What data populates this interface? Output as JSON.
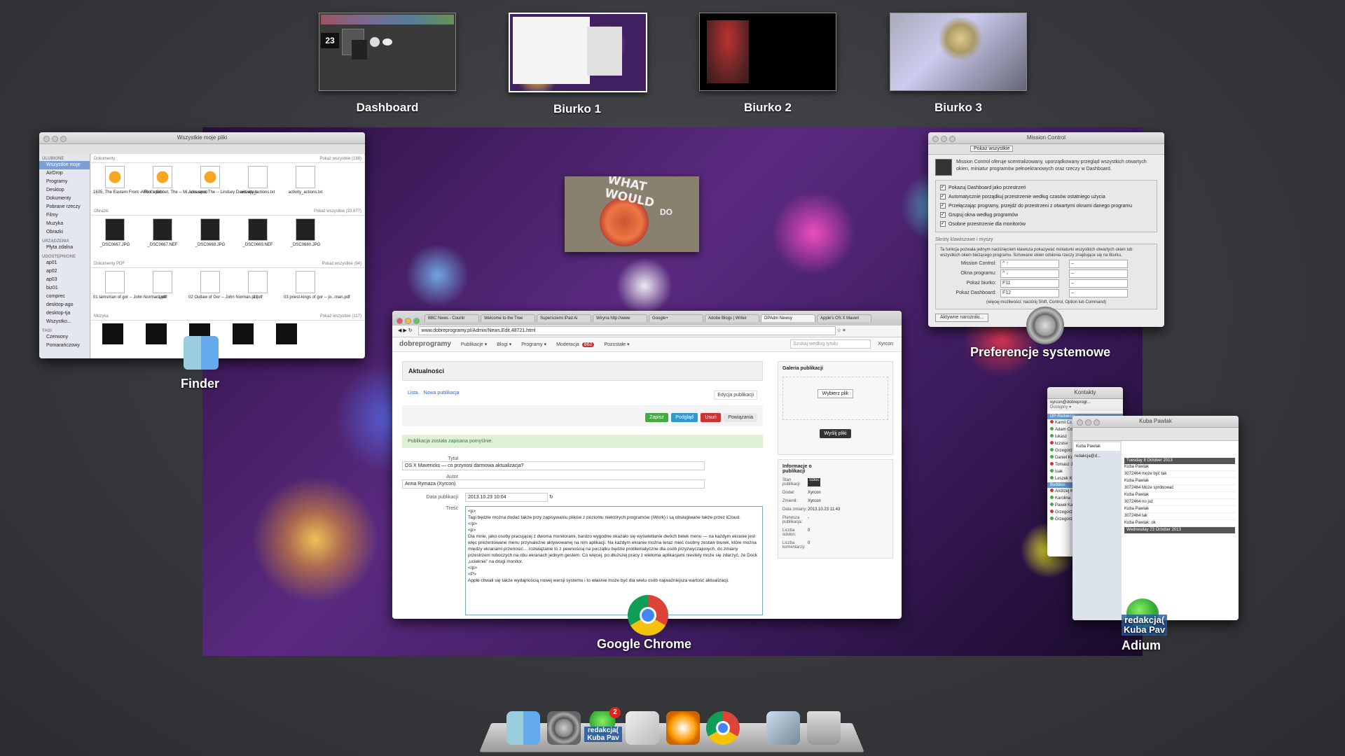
{
  "spaces": [
    {
      "label": "Dashboard"
    },
    {
      "label": "Biurko 1"
    },
    {
      "label": "Biurko 2"
    },
    {
      "label": "Biurko 3"
    }
  ],
  "dashboard_thumb": {
    "date": "23"
  },
  "finder": {
    "app_label": "Finder",
    "title": "Wszystkie moje pliki",
    "sidebar_sections": [
      {
        "head": "ULUBIONE",
        "items": [
          "Wszystkie moje",
          "AirDrop",
          "Programy",
          "Desktop",
          "Dokumenty",
          "Pobrane rzeczy",
          "Filmy",
          "Muzyka",
          "Obrazki"
        ]
      },
      {
        "head": "URZĄDZENIA",
        "items": [
          "Płyta zdalna"
        ]
      },
      {
        "head": "UDOSTĘPNIONE",
        "items": [
          "ap01",
          "ap02",
          "ap03",
          "biz01",
          "comprec",
          "desktop-ago",
          "desktop-tja",
          "Wszystko..."
        ]
      },
      {
        "head": "TAGI",
        "items": [
          "Czerwony",
          "Pomarańczowy"
        ]
      }
    ],
    "groups": [
      {
        "name": "Dokumenty",
        "more": "Pokaż wszystkie (198)",
        "files": [
          "1635, The Eastern Front -- Flint.epub",
          "Abbot's Gibbet, The -- Mi...cks.epub",
          "Accusers, The -- Lindsey Davis.epub",
          "activity_actions.txt",
          "activity_actions.txt"
        ]
      },
      {
        "name": "Obrazki",
        "more": "Pokaż wszystkie (33 877)",
        "files": [
          "_DSC0667.JPG",
          "_DSC0667.NEF",
          "_DSC0669.JPG",
          "_DSC0669.NEF",
          "_DSC0680.JPG"
        ]
      },
      {
        "name": "Dokumenty PDF",
        "more": "Pokaż wszystkie (94)",
        "files": [
          "01 tamsman of gor -- John Norman.pdf",
          "1.pdf",
          "02 Outlaw of Gor -- John Norman.pcf",
          "2.pdf",
          "03 priest-kings of gor -- jo...man.pdf"
        ]
      },
      {
        "name": "Muzyka",
        "more": "Pokaż wszystkie (117)",
        "files": []
      }
    ]
  },
  "what_would": {
    "line1": "WHAT WOULD",
    "line2": "DO"
  },
  "chrome": {
    "app_label": "Google Chrome",
    "tabs": [
      "BBC News - Countr",
      "Welcome to the Tree",
      "Superściemi iPad Ai",
      "Wiryna http://www",
      "Google+",
      "Adobe Blogs | Writer",
      "DPAdm Newsy",
      "Apple's OS X Maveri"
    ],
    "url": "www.dobreprogramy.pl/Admin/News,Edit,48721.html",
    "site": "dobreprogramy",
    "nav": [
      "Publikacje ▾",
      "Blogi ▾",
      "Programy ▾",
      "Moderacja",
      "Pozostałe ▾"
    ],
    "moderation_badge": "862",
    "search_placeholder": "Szukaj według tytułu",
    "user": "Xyrcon",
    "section_title": "Aktualności",
    "sub_links": [
      "Lista",
      "Nowa publikacja"
    ],
    "edit_label": "Edycja publikacji",
    "buttons": {
      "save": "Zapisz",
      "preview": "Podgląd",
      "delete": "Usuń",
      "restore": "Powiązania"
    },
    "success_msg": "Publikacja została zapisana pomyślnie.",
    "fields": {
      "title_label": "Tytuł",
      "title_value": "OS X Mavericks — co przynosi darmowa aktualizacja?",
      "author_label": "Autor",
      "author_value": "Anna Rymaza (Xyrcon)",
      "date_label": "Data publikacji",
      "date_value": "2013.10.23 10:04",
      "content_label": "Treść"
    },
    "content_lines": [
      "<p>",
      "Tagi będzie można dodać także przy zapisywaniu plików z poziomu niektórych programów (iWork) i są obsługiwane także przez iCloud.",
      "</p>",
      "<p>",
      "Dla mnie, jako osoby pracującej z dwoma monitorami, bardzo wygodne okazało się wyświetlanie dwóch belek menu — na każdym ekranie jest więc prezentowane menu przynależne aktywowanej na nim aplikacji. Na każdym ekranie można teraz mieć osobny zestaw biurek, które można między ekranami przenosić… rozwiązanie to z pewnością na początku będzie problematyczne dla osób przyzwyczajonych, do zmiany przestrzeni roboczych na obu ekranach jednym gestem. Co więcej, po dłuższej pracy z wieloma aplikacjami niestety może się zdarzyć, że Dock „ucieknie” na drugi monitor.",
      "</p>",
      "<P>",
      "Apple chwali się także wydajnością nowej wersji systemu i to właśnie może być dla wielu osób najważniejsza wartość aktualizacji."
    ],
    "gallery_title": "Galeria publikacji",
    "choose_file": "Wybierz plik",
    "upload": "Wyślij pliki",
    "info_title": "Informacje o publikacji",
    "info": [
      {
        "k": "Stan publikacji",
        "v": "Szkic"
      },
      {
        "k": "Dodał:",
        "v": "Xyrcon"
      },
      {
        "k": "Zmienił:",
        "v": "Xyrcon"
      },
      {
        "k": "Data zmiany:",
        "v": "2013.10.23 11:43"
      },
      {
        "k": "Pierwsza publikacja:",
        "v": "-"
      },
      {
        "k": "Liczba odsłon:",
        "v": "0"
      },
      {
        "k": "Liczba komentarzy:",
        "v": "0"
      }
    ]
  },
  "mission_control": {
    "app_label": "Preferencje systemowe",
    "title": "Mission Control",
    "show_all": "Pokaż wszystkie",
    "desc": "Mission Control oferuje scentralizowany, uporządkowany przegląd wszystkich otwartych okien, miniatur programów pełnoekranowych oraz rzeczy w Dashboard.",
    "checks": [
      "Pokazuj Dashboard jako przestrzeń",
      "Automatycznie porządkuj przestrzenie według czasów ostatniego użycia",
      "Przełączając programy, przejdź do przestrzeni z otwartymi oknami danego programu",
      "Grupuj okna według programów",
      "Osobne przestrzenie dla monitorów"
    ],
    "shortcuts_head": "Skróty klawiszowe i myszy",
    "shortcuts_desc": "Ta funkcja pozwala jednym naciśnięciem klawisza pokazywać miniaturki wszystkich otwartych okien lub wszystkich okien bieżącego programu. Schowane okien odsłonia rzeczy znajdujące się na Biurku.",
    "rows": [
      {
        "k": "Mission Control:",
        "v": "^ ↑",
        "m": "–"
      },
      {
        "k": "Okna programu:",
        "v": "^ ↓",
        "m": "–"
      },
      {
        "k": "Pokaż biurko:",
        "v": "F11",
        "m": "–"
      },
      {
        "k": "Pokaż Dashboard:",
        "v": "F12",
        "m": "–"
      }
    ],
    "modifier_note": "(więcej możliwości: naciśnij Shift, Control, Option lub Command)",
    "hot_corners": "Aktywne narożniki..."
  },
  "adium": {
    "app_label_1": "redakcja(",
    "app_label_2": "Kuba Pav",
    "app_label": "Adium",
    "contacts_title": "Kontakty",
    "me": "xyrcon@dobreprogr...",
    "status": "Dostępny ▾",
    "group1": "DP-Redakcja",
    "contacts": [
      "Kamil Cz.",
      "Adam Co",
      "lukasz",
      "krzslsv",
      "Grzegorz",
      "Daniel Ko",
      "Tomasz J",
      "Isak",
      "Leszek K"
    ],
    "group2": "Buddies",
    "contacts2": [
      "Andrzej K",
      "Karolina",
      "Paweł Ka",
      "Grzegorz",
      "Grzegorz"
    ],
    "chat_title": "Kuba Pawlak",
    "chat_tabs": [
      "Kuba Pawlak",
      "redakcja@d..."
    ],
    "day1": "Tuesday 8 October 2013",
    "day2": "Wednesday 23 October 2013",
    "msgs": [
      "Kuba Pawlak",
      "3072464 może być tak",
      "Kuba Pawlak",
      "3072464 Może spróbować",
      "Kuba Pawlak",
      "3072464 no już",
      "Kuba Pawlak",
      "3072464 tak",
      "Kuba Pawlak: ok"
    ],
    "badge": "2"
  },
  "dock_items": [
    "finder",
    "system-prefs",
    "adium",
    "preview",
    "dictionary",
    "ibooks",
    "chrome",
    "utility",
    "trash"
  ],
  "dock_adium_label1": "redakcja(",
  "dock_adium_label2": "Kuba Pav"
}
